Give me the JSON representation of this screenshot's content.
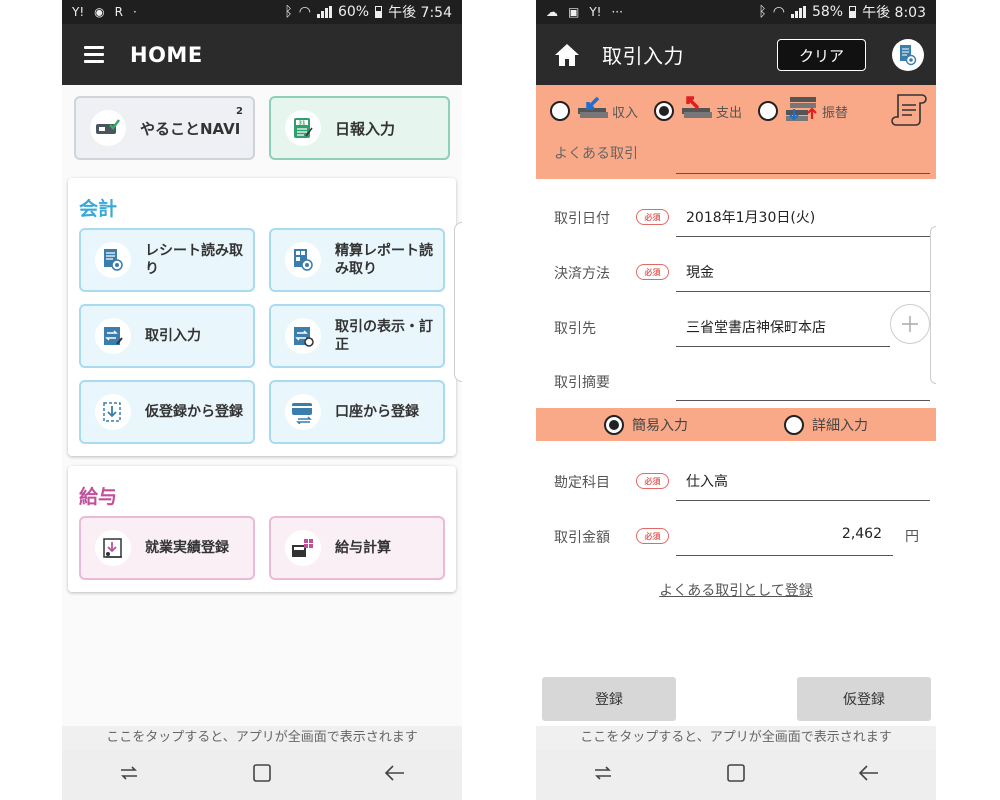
{
  "left": {
    "status": {
      "icons_left": [
        "Y!",
        "◉",
        "R",
        "·"
      ],
      "battery": "60%",
      "time": "午後 7:54"
    },
    "appbar": {
      "title": "HOME"
    },
    "top_tiles": [
      {
        "label": "やることNAVI",
        "badge": "2"
      },
      {
        "label": "日報入力"
      }
    ],
    "accounting": {
      "heading": "会計",
      "heading_color": "#3aa8d8",
      "items": [
        {
          "label": "レシート読み取り"
        },
        {
          "label": "精算レポート読み取り"
        },
        {
          "label": "取引入力"
        },
        {
          "label": "取引の表示・訂正"
        },
        {
          "label": "仮登録から登録"
        },
        {
          "label": "口座から登録"
        }
      ]
    },
    "payroll": {
      "heading": "給与",
      "heading_color": "#c14f9c",
      "items": [
        {
          "label": "就業実績登録"
        },
        {
          "label": "給与計算"
        }
      ]
    },
    "footer_text": "ここをタップすると、アプリが全画面で表示されます"
  },
  "right": {
    "status": {
      "icons_left": [
        "☁",
        "▣",
        "Y!",
        "···"
      ],
      "battery": "58%",
      "time": "午後 8:03"
    },
    "appbar": {
      "title": "取引入力",
      "clear_label": "クリア"
    },
    "types": [
      {
        "label": "収入",
        "selected": false
      },
      {
        "label": "支出",
        "selected": true
      },
      {
        "label": "振替",
        "selected": false
      }
    ],
    "frequent_label": "よくある取引",
    "required_badge": "必須",
    "fields": {
      "date": {
        "label": "取引日付",
        "value": "2018年1月30日(火)"
      },
      "payment": {
        "label": "決済方法",
        "value": "現金"
      },
      "partner": {
        "label": "取引先",
        "value": "三省堂書店神保町本店"
      },
      "memo": {
        "label": "取引摘要",
        "value": ""
      },
      "account": {
        "label": "勘定科目",
        "value": "仕入高"
      },
      "amount": {
        "label": "取引金額",
        "value": "2,462",
        "unit": "円"
      }
    },
    "modes": [
      {
        "label": "簡易入力",
        "selected": true
      },
      {
        "label": "詳細入力",
        "selected": false
      }
    ],
    "register_frequent_link": "よくある取引として登録",
    "buttons": {
      "register": "登録",
      "temp_register": "仮登録"
    },
    "footer_text": "ここをタップすると、アプリが全画面で表示されます",
    "accent_color": "#f9a988"
  }
}
